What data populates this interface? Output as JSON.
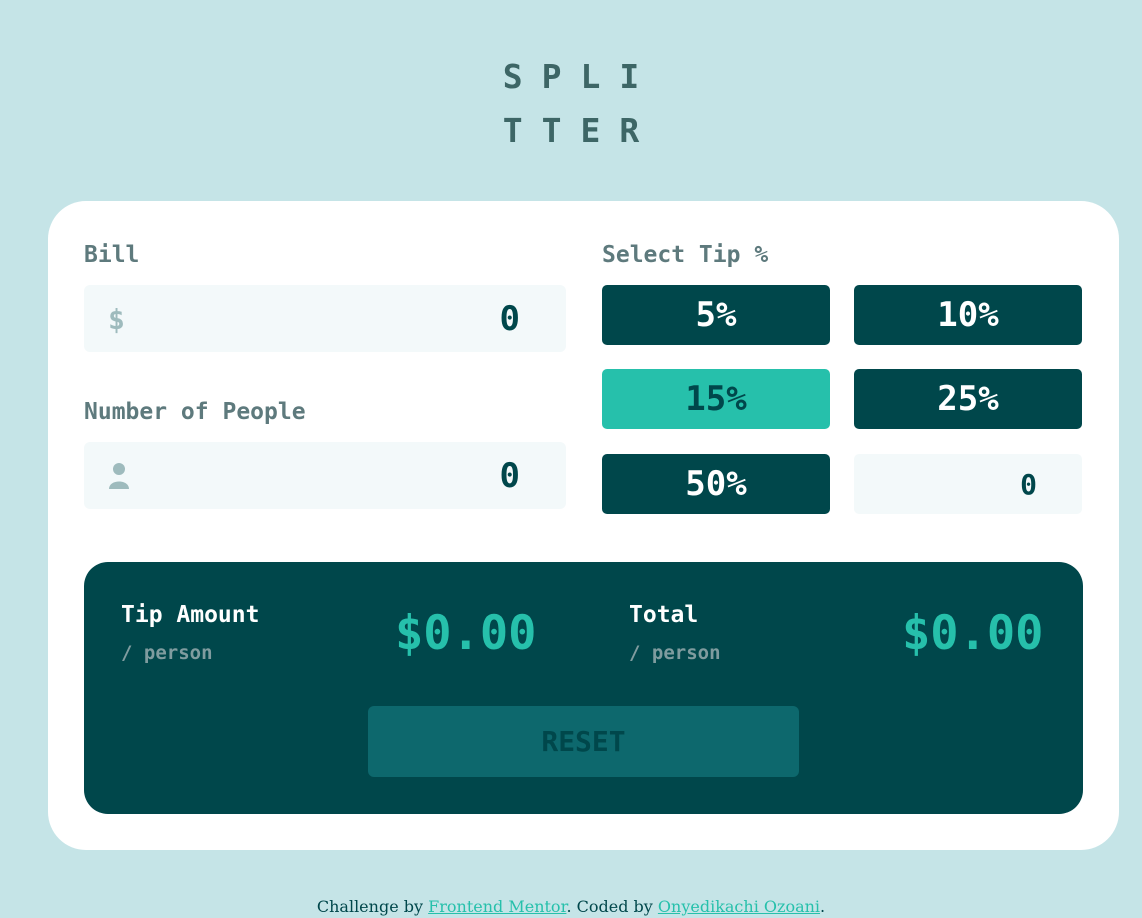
{
  "logo": {
    "line1": "SPLI",
    "line2": "TTER"
  },
  "bill": {
    "label": "Bill",
    "icon": "dollar-icon",
    "icon_glyph": "$",
    "value": "0"
  },
  "people": {
    "label": "Number of People",
    "icon": "person-icon",
    "value": "0"
  },
  "tip": {
    "label": "Select Tip %",
    "options": [
      "5%",
      "10%",
      "15%",
      "25%",
      "50%"
    ],
    "selected": "15%",
    "custom_value": "0"
  },
  "results": {
    "tip_title": "Tip Amount",
    "tip_sub": "/ person",
    "tip_value": "$0.00",
    "total_title": "Total",
    "total_sub": "/ person",
    "total_value": "$0.00",
    "reset_label": "RESET"
  },
  "footer": {
    "prefix": "Challenge by ",
    "link1": "Frontend Mentor",
    "middle": ". Coded by ",
    "link2": "Onyedikachi Ozoani",
    "suffix": "."
  },
  "colors": {
    "background": "#c5e4e7",
    "dark_cyan": "#00474b",
    "accent": "#26c0ab",
    "input_bg": "#f3f9fa"
  }
}
